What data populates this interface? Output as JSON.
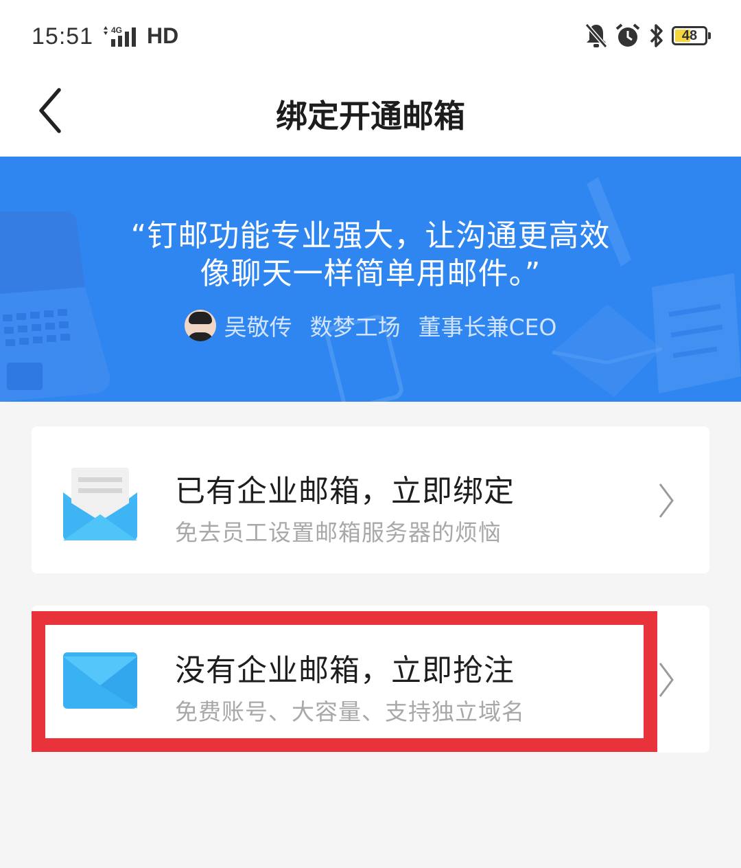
{
  "status_bar": {
    "time": "15:51",
    "network": "4G",
    "hd": "HD",
    "battery_level": "48",
    "icons": [
      "mute-icon",
      "alarm-icon",
      "bluetooth-icon",
      "battery-icon"
    ]
  },
  "nav": {
    "title": "绑定开通邮箱",
    "back_icon": "chevron-left-icon"
  },
  "banner": {
    "quote_line1": "“钉邮功能专业强大，让沟通更高效",
    "quote_line2": "像聊天一样简单用邮件。”",
    "author_name": "吴敬传",
    "author_company": "数梦工场",
    "author_title": "董事长兼CEO"
  },
  "options": [
    {
      "title": "已有企业邮箱，立即绑定",
      "subtitle": "免去员工设置邮箱服务器的烦恼",
      "icon": "open-envelope-icon"
    },
    {
      "title": "没有企业邮箱，立即抢注",
      "subtitle": "免费账号、大容量、支持独立域名",
      "icon": "envelope-icon"
    }
  ],
  "colors": {
    "banner_bg": "#2f86f0",
    "highlight": "#e8333a",
    "envelope": "#3fb6f5"
  }
}
